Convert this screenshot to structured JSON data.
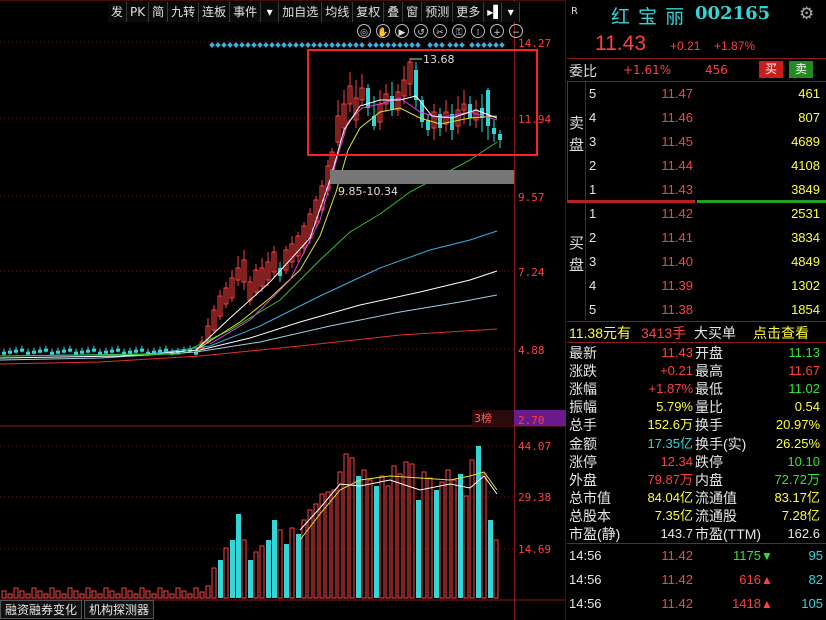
{
  "toolbar": {
    "items": [
      "发",
      "PK",
      "简",
      "九转",
      "连板",
      "事件",
      "▾",
      "加自选",
      "均线",
      "复权",
      "叠",
      "窗",
      "预测",
      "更多",
      "▸▌",
      "▾"
    ]
  },
  "chart": {
    "price_ticks": [
      "14.27",
      "11.94",
      "9.57",
      "7.24",
      "4.88",
      "2.70"
    ],
    "vol_ticks": [
      "44.07",
      "29.38",
      "14.69"
    ],
    "high_label": "13.68",
    "zone_label": "9.85-10.34",
    "bang_label": "3榜",
    "diamond_color": "#3ab0e0"
  },
  "panel": {
    "r_badge": "R",
    "stock_name": "红 宝 丽",
    "stock_code": "002165",
    "price": "11.43",
    "change": "+0.21",
    "change_pct": "+1.87%",
    "weibi_label": "委比",
    "weibi_value": "+1.61%",
    "weibi_diff": "456",
    "buy_btn": "买",
    "sell_btn": "卖",
    "sell_side_label": [
      "卖",
      "盘"
    ],
    "buy_side_label": [
      "买",
      "盘"
    ],
    "asks": [
      {
        "lvl": "5",
        "price": "11.47",
        "vol": "461"
      },
      {
        "lvl": "4",
        "price": "11.46",
        "vol": "807"
      },
      {
        "lvl": "3",
        "price": "11.45",
        "vol": "4689"
      },
      {
        "lvl": "2",
        "price": "11.44",
        "vol": "4108"
      },
      {
        "lvl": "1",
        "price": "11.43",
        "vol": "3849"
      }
    ],
    "bids": [
      {
        "lvl": "1",
        "price": "11.42",
        "vol": "2531"
      },
      {
        "lvl": "2",
        "price": "11.41",
        "vol": "3834"
      },
      {
        "lvl": "3",
        "price": "11.40",
        "vol": "4849"
      },
      {
        "lvl": "4",
        "price": "11.39",
        "vol": "1302"
      },
      {
        "lvl": "5",
        "price": "11.38",
        "vol": "1854"
      }
    ],
    "bigorder": {
      "price": "11.38元有",
      "qty": "3413手",
      "label": "大买单",
      "link": "点击查看"
    },
    "stats": [
      {
        "l1": "最新",
        "v1": "11.43",
        "c1": "r",
        "l2": "开盘",
        "v2": "11.13",
        "c2": "g"
      },
      {
        "l1": "涨跌",
        "v1": "+0.21",
        "c1": "r",
        "l2": "最高",
        "v2": "11.67",
        "c2": "r"
      },
      {
        "l1": "涨幅",
        "v1": "+1.87%",
        "c1": "r",
        "l2": "最低",
        "v2": "11.02",
        "c2": "g"
      },
      {
        "l1": "振幅",
        "v1": "5.79%",
        "c1": "y",
        "l2": "量比",
        "v2": "0.54",
        "c2": "y"
      },
      {
        "l1": "总手",
        "v1": "152.6万",
        "c1": "y",
        "l2": "换手",
        "v2": "20.97%",
        "c2": "y"
      },
      {
        "l1": "金额",
        "v1": "17.35亿",
        "c1": "c",
        "l2": "换手(实)",
        "v2": "26.25%",
        "c2": "y"
      },
      {
        "l1": "涨停",
        "v1": "12.34",
        "c1": "r",
        "l2": "跌停",
        "v2": "10.10",
        "c2": "g"
      },
      {
        "l1": "外盘",
        "v1": "79.87万",
        "c1": "r",
        "l2": "内盘",
        "v2": "72.72万",
        "c2": "g"
      },
      {
        "l1": "总市值",
        "v1": "84.04亿",
        "c1": "y",
        "l2": "流通值",
        "v2": "83.17亿",
        "c2": "y"
      },
      {
        "l1": "总股本",
        "v1": "7.35亿",
        "c1": "y",
        "l2": "流通股",
        "v2": "7.28亿",
        "c2": "y"
      },
      {
        "l1": "市盈(静)",
        "v1": "143.7",
        "c1": "w",
        "l2": "市盈(TTM)",
        "v2": "162.6",
        "c2": "w"
      }
    ],
    "ticks": [
      {
        "time": "14:56",
        "price": "11.42",
        "vol": "1175",
        "dir": "down",
        "num": "95"
      },
      {
        "time": "14:56",
        "price": "11.42",
        "vol": "616",
        "dir": "up",
        "num": "82"
      },
      {
        "time": "14:56",
        "price": "11.42",
        "vol": "1418",
        "dir": "up",
        "num": "105"
      }
    ]
  },
  "bottom_tabs": [
    "融资融券变化",
    "机构探测器"
  ]
}
